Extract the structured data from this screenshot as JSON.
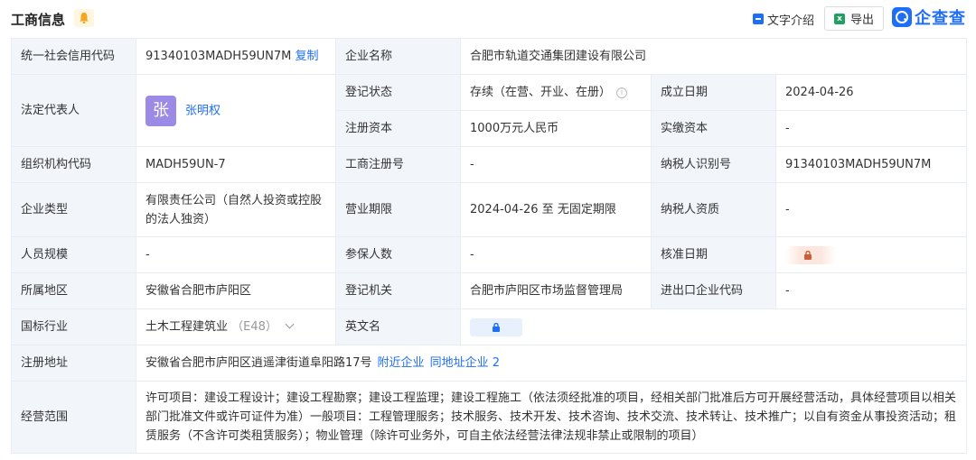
{
  "header": {
    "title": "工商信息",
    "text_intro": "文字介绍",
    "export": "导出",
    "brand": "企查查"
  },
  "rows": {
    "credit_code": {
      "label": "统一社会信用代码",
      "value": "91340103MADH59UN7M",
      "copy": "复制"
    },
    "company_name": {
      "label": "企业名称",
      "value": "合肥市轨道交通集团建设有限公司"
    },
    "legal_rep": {
      "label": "法定代表人",
      "avatar": "张",
      "name": "张明权"
    },
    "reg_status": {
      "label": "登记状态",
      "value": "存续（在营、开业、在册）"
    },
    "est_date": {
      "label": "成立日期",
      "value": "2024-04-26"
    },
    "reg_capital": {
      "label": "注册资本",
      "value": "1000万元人民币"
    },
    "paid_capital": {
      "label": "实缴资本",
      "value": "-"
    },
    "org_code": {
      "label": "组织机构代码",
      "value": "MADH59UN-7"
    },
    "biz_reg_no": {
      "label": "工商注册号",
      "value": "-"
    },
    "taxpayer_id": {
      "label": "纳税人识别号",
      "value": "91340103MADH59UN7M"
    },
    "company_type": {
      "label": "企业类型",
      "value": "有限责任公司（自然人投资或控股的法人独资）"
    },
    "biz_term": {
      "label": "营业期限",
      "value": "2024-04-26 至 无固定期限"
    },
    "taxpayer_qual": {
      "label": "纳税人资质",
      "value": "-"
    },
    "staff_size": {
      "label": "人员规模",
      "value": "-"
    },
    "insured": {
      "label": "参保人数",
      "value": "-"
    },
    "approval_date": {
      "label": "核准日期"
    },
    "region": {
      "label": "所属地区",
      "value": "安徽省合肥市庐阳区"
    },
    "reg_authority": {
      "label": "登记机关",
      "value": "合肥市庐阳区市场监督管理局"
    },
    "import_export": {
      "label": "进出口企业代码",
      "value": "-"
    },
    "industry": {
      "label": "国标行业",
      "value": "土木工程建筑业",
      "code": "（E48）"
    },
    "english_name": {
      "label": "英文名"
    },
    "address": {
      "label": "注册地址",
      "value": "安徽省合肥市庐阳区逍遥津街道阜阳路17号",
      "nearby": "附近企业",
      "same_addr": "同地址企业 2"
    },
    "scope": {
      "label": "经营范围",
      "value": "许可项目：建设工程设计；建设工程勘察；建设工程监理；建设工程施工（依法须经批准的项目，经相关部门批准后方可开展经营活动，具体经营项目以相关部门批准文件或许可证件为准）一般项目：工程管理服务；技术服务、技术开发、技术咨询、技术交流、技术转让、技术推广；以自有资金从事投资活动；租赁服务（不含许可类租赁服务）；物业管理（除许可业务外，可自主依法经营法律法规非禁止或限制的项目）"
    }
  },
  "colors": {
    "accent": "#1f6ef7",
    "label_bg": "#f2f5fa",
    "border": "#e8ecf3",
    "avatar": "#9b8ae6"
  },
  "icons": [
    "bell-icon",
    "doc-icon",
    "excel-icon",
    "brand-logo-icon",
    "info-icon",
    "chevron-down-icon",
    "lock-icon"
  ]
}
